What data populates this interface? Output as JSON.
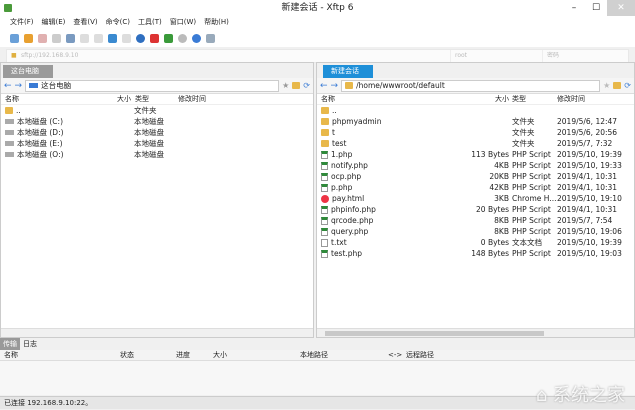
{
  "title": "新建会话 - Xftp 6",
  "menu": [
    "文件(F)",
    "编辑(E)",
    "查看(V)",
    "命令(C)",
    "工具(T)",
    "窗口(W)",
    "帮助(H)"
  ],
  "address": {
    "url": "sftp://192.168.9.10",
    "user_placeholder": "root",
    "password_placeholder": "密码"
  },
  "left": {
    "tab": "这台电脑",
    "path": "这台电脑",
    "headers": [
      "名称",
      "大小",
      "类型",
      "修改时间"
    ],
    "rows": [
      {
        "name": "..",
        "size": "",
        "type": "文件夹",
        "time": "",
        "icon": "folder"
      },
      {
        "name": "本地磁盘 (C:)",
        "size": "",
        "type": "本地磁盘",
        "time": "",
        "icon": "drive"
      },
      {
        "name": "本地磁盘 (D:)",
        "size": "",
        "type": "本地磁盘",
        "time": "",
        "icon": "drive"
      },
      {
        "name": "本地磁盘 (E:)",
        "size": "",
        "type": "本地磁盘",
        "time": "",
        "icon": "drive"
      },
      {
        "name": "本地磁盘 (O:)",
        "size": "",
        "type": "本地磁盘",
        "time": "",
        "icon": "drive"
      }
    ]
  },
  "right": {
    "tab": "新建会话",
    "path": "/home/wwwroot/default",
    "headers": [
      "名称",
      "大小",
      "类型",
      "修改时间"
    ],
    "rows": [
      {
        "name": "..",
        "size": "",
        "type": "",
        "time": "",
        "icon": "folder"
      },
      {
        "name": "phpmyadmin",
        "size": "",
        "type": "文件夹",
        "time": "2019/5/6, 12:47",
        "icon": "folder"
      },
      {
        "name": "t",
        "size": "",
        "type": "文件夹",
        "time": "2019/5/6, 20:56",
        "icon": "folder"
      },
      {
        "name": "test",
        "size": "",
        "type": "文件夹",
        "time": "2019/5/7, 7:32",
        "icon": "folder"
      },
      {
        "name": "1.php",
        "size": "113 Bytes",
        "type": "PHP Script",
        "time": "2019/5/10, 19:39",
        "icon": "php"
      },
      {
        "name": "notify.php",
        "size": "4KB",
        "type": "PHP Script",
        "time": "2019/5/10, 19:33",
        "icon": "php"
      },
      {
        "name": "ocp.php",
        "size": "20KB",
        "type": "PHP Script",
        "time": "2019/4/1, 10:31",
        "icon": "php"
      },
      {
        "name": "p.php",
        "size": "42KB",
        "type": "PHP Script",
        "time": "2019/4/1, 10:31",
        "icon": "php"
      },
      {
        "name": "pay.html",
        "size": "3KB",
        "type": "Chrome H...",
        "time": "2019/5/10, 19:10",
        "icon": "html"
      },
      {
        "name": "phpinfo.php",
        "size": "20 Bytes",
        "type": "PHP Script",
        "time": "2019/4/1, 10:31",
        "icon": "php"
      },
      {
        "name": "qrcode.php",
        "size": "8KB",
        "type": "PHP Script",
        "time": "2019/5/7, 7:54",
        "icon": "php"
      },
      {
        "name": "query.php",
        "size": "8KB",
        "type": "PHP Script",
        "time": "2019/5/10, 19:06",
        "icon": "php"
      },
      {
        "name": "t.txt",
        "size": "0 Bytes",
        "type": "文本文档",
        "time": "2019/5/10, 19:39",
        "icon": "txt"
      },
      {
        "name": "test.php",
        "size": "148 Bytes",
        "type": "PHP Script",
        "time": "2019/5/10, 19:03",
        "icon": "php"
      }
    ]
  },
  "transfer": {
    "tabs": [
      "传输",
      "日志"
    ],
    "headers": [
      "名称",
      "状态",
      "进度",
      "大小",
      "本地路径",
      "<->",
      "远程路径"
    ]
  },
  "status": "已连接 192.168.9.10:22。",
  "watermark": "系统之家"
}
